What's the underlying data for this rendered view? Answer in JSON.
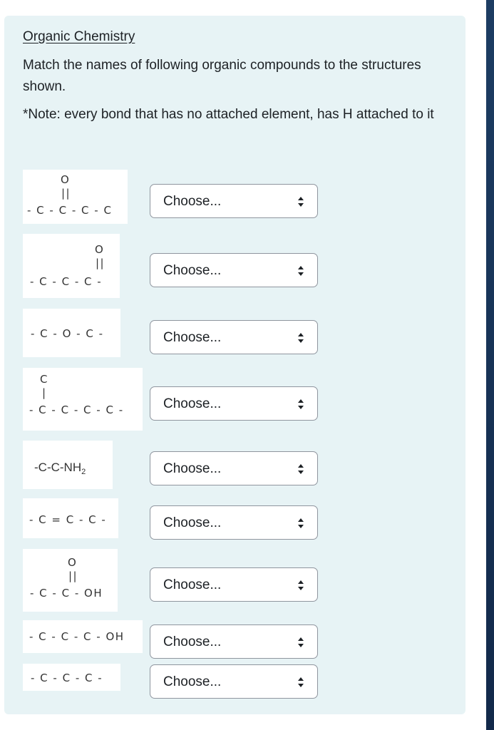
{
  "question": {
    "title": "Organic Chemistry",
    "prompt": "Match the names of following organic compounds to the structures shown.",
    "note": "*Note: every bond that has no attached element, has H attached to it"
  },
  "structures": [
    {
      "top_line": "O",
      "bond_line": "||",
      "main_line": "- C - C - C - C"
    },
    {
      "top_line": "O",
      "bond_line": "||",
      "main_line": "- C - C - C -"
    },
    {
      "main_line": "- C - O - C -"
    },
    {
      "top_line": "C",
      "bond_line": "|",
      "main_line": "- C - C - C - C -"
    },
    {
      "main_line": "-C-C-NH",
      "subscript": "2"
    },
    {
      "main_line": "- C = C - C -"
    },
    {
      "top_line": "O",
      "bond_line": "||",
      "main_line": "- C - C - OH"
    },
    {
      "main_line": "- C - C - C - OH"
    },
    {
      "main_line": "- C - C - C -"
    }
  ],
  "answers": [
    {
      "selected": "Choose..."
    },
    {
      "selected": "Choose..."
    },
    {
      "selected": "Choose..."
    },
    {
      "selected": "Choose..."
    },
    {
      "selected": "Choose..."
    },
    {
      "selected": "Choose..."
    },
    {
      "selected": "Choose..."
    },
    {
      "selected": "Choose..."
    },
    {
      "selected": "Choose..."
    }
  ],
  "icons": {
    "select_arrow": "up-down-caret-icon"
  },
  "colors": {
    "card_background": "#e7f3f5",
    "text": "#1d2125",
    "select_border": "#8f959e"
  }
}
